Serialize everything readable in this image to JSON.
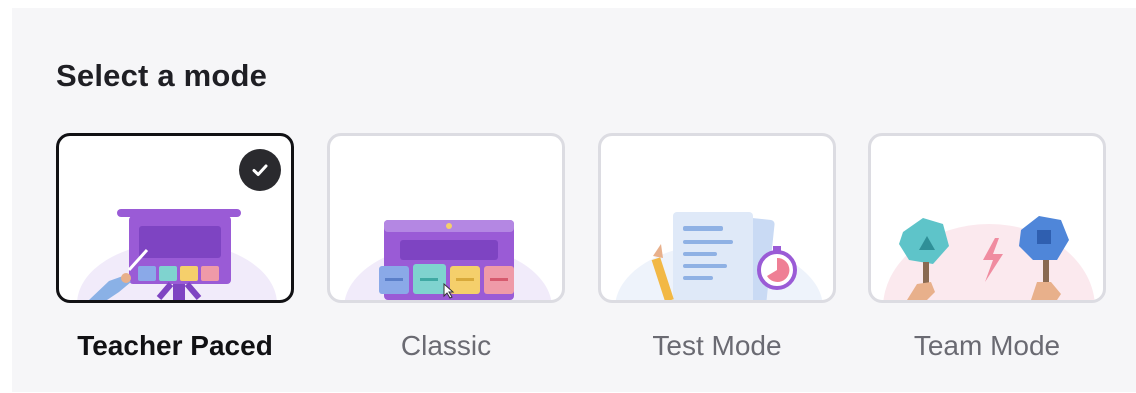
{
  "heading": "Select a mode",
  "modes": [
    {
      "label": "Teacher Paced",
      "selected": true
    },
    {
      "label": "Classic",
      "selected": false
    },
    {
      "label": "Test Mode",
      "selected": false
    },
    {
      "label": "Team Mode",
      "selected": false
    }
  ],
  "colors": {
    "selected_border": "#111114",
    "card_border": "#dcdce2",
    "accent_purple": "#9a5bd6",
    "check_bg": "#2a2a2e"
  }
}
